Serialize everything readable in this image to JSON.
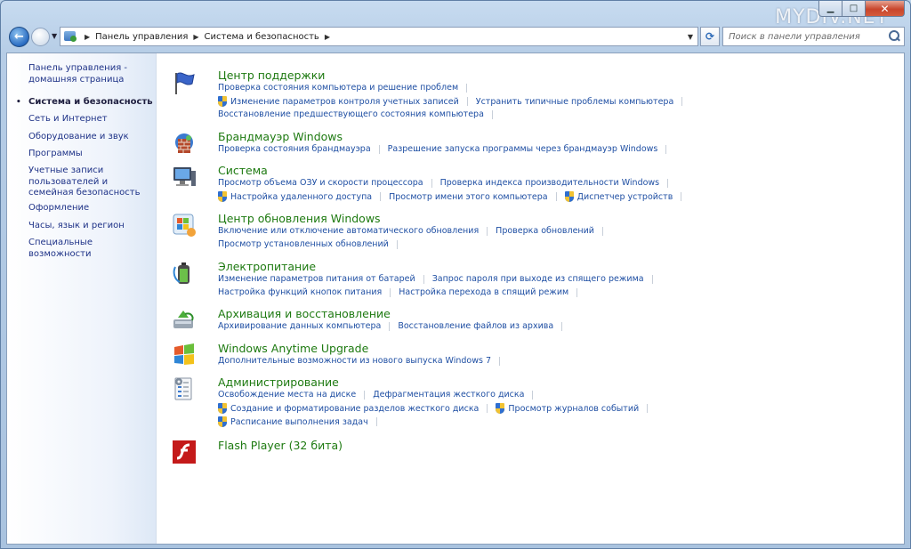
{
  "watermark": "MYDIV.NET",
  "address": {
    "crumbs": [
      "Панель управления",
      "Система и безопасность"
    ]
  },
  "search": {
    "placeholder": "Поиск в панели управления"
  },
  "sidebar": {
    "items": [
      {
        "label": "Панель управления - домашняя страница",
        "current": false
      },
      {
        "label": "Система и безопасность",
        "current": true
      },
      {
        "label": "Сеть и Интернет",
        "current": false
      },
      {
        "label": "Оборудование и звук",
        "current": false
      },
      {
        "label": "Программы",
        "current": false
      },
      {
        "label": "Учетные записи пользователей и семейная безопасность",
        "current": false
      },
      {
        "label": "Оформление",
        "current": false
      },
      {
        "label": "Часы, язык и регион",
        "current": false
      },
      {
        "label": "Специальные возможности",
        "current": false
      }
    ]
  },
  "categories": [
    {
      "title": "Центр поддержки",
      "icon": "flag-icon",
      "rows": [
        [
          {
            "label": "Проверка состояния компьютера и решение проблем",
            "shield": false
          }
        ],
        [
          {
            "label": "Изменение параметров контроля учетных записей",
            "shield": true
          },
          {
            "label": "Устранить типичные проблемы компьютера",
            "shield": false
          }
        ],
        [
          {
            "label": "Восстановление предшествующего состояния компьютера",
            "shield": false
          }
        ]
      ]
    },
    {
      "title": "Брандмауэр Windows",
      "icon": "firewall-icon",
      "rows": [
        [
          {
            "label": "Проверка состояния брандмауэра",
            "shield": false
          },
          {
            "label": "Разрешение запуска программы через брандмауэр Windows",
            "shield": false
          }
        ]
      ]
    },
    {
      "title": "Система",
      "icon": "computer-icon",
      "rows": [
        [
          {
            "label": "Просмотр объема ОЗУ и скорости процессора",
            "shield": false
          },
          {
            "label": "Проверка индекса производительности Windows",
            "shield": false
          }
        ],
        [
          {
            "label": "Настройка удаленного доступа",
            "shield": true
          },
          {
            "label": "Просмотр имени этого компьютера",
            "shield": false
          },
          {
            "label": "Диспетчер устройств",
            "shield": true
          }
        ]
      ]
    },
    {
      "title": "Центр обновления Windows",
      "icon": "windows-update-icon",
      "rows": [
        [
          {
            "label": "Включение или отключение автоматического обновления",
            "shield": false
          },
          {
            "label": "Проверка обновлений",
            "shield": false
          }
        ],
        [
          {
            "label": "Просмотр установленных обновлений",
            "shield": false
          }
        ]
      ]
    },
    {
      "title": "Электропитание",
      "icon": "power-icon",
      "rows": [
        [
          {
            "label": "Изменение параметров питания от батарей",
            "shield": false
          },
          {
            "label": "Запрос пароля при выходе из спящего режима",
            "shield": false
          }
        ],
        [
          {
            "label": "Настройка функций кнопок питания",
            "shield": false
          },
          {
            "label": "Настройка перехода в спящий режим",
            "shield": false
          }
        ]
      ]
    },
    {
      "title": "Архивация и восстановление",
      "icon": "backup-icon",
      "rows": [
        [
          {
            "label": "Архивирование данных компьютера",
            "shield": false
          },
          {
            "label": "Восстановление файлов из архива",
            "shield": false
          }
        ]
      ]
    },
    {
      "title": "Windows Anytime Upgrade",
      "icon": "windows-logo-icon",
      "rows": [
        [
          {
            "label": "Дополнительные возможности из нового выпуска Windows 7",
            "shield": false
          }
        ]
      ]
    },
    {
      "title": "Администрирование",
      "icon": "admin-tools-icon",
      "rows": [
        [
          {
            "label": "Освобождение места на диске",
            "shield": false
          },
          {
            "label": "Дефрагментация жесткого диска",
            "shield": false
          }
        ],
        [
          {
            "label": "Создание и форматирование разделов жесткого диска",
            "shield": true
          },
          {
            "label": "Просмотр журналов событий",
            "shield": true
          }
        ],
        [
          {
            "label": "Расписание выполнения задач",
            "shield": true
          }
        ]
      ]
    },
    {
      "title": "Flash Player (32 бита)",
      "icon": "flash-player-icon",
      "rows": []
    }
  ]
}
